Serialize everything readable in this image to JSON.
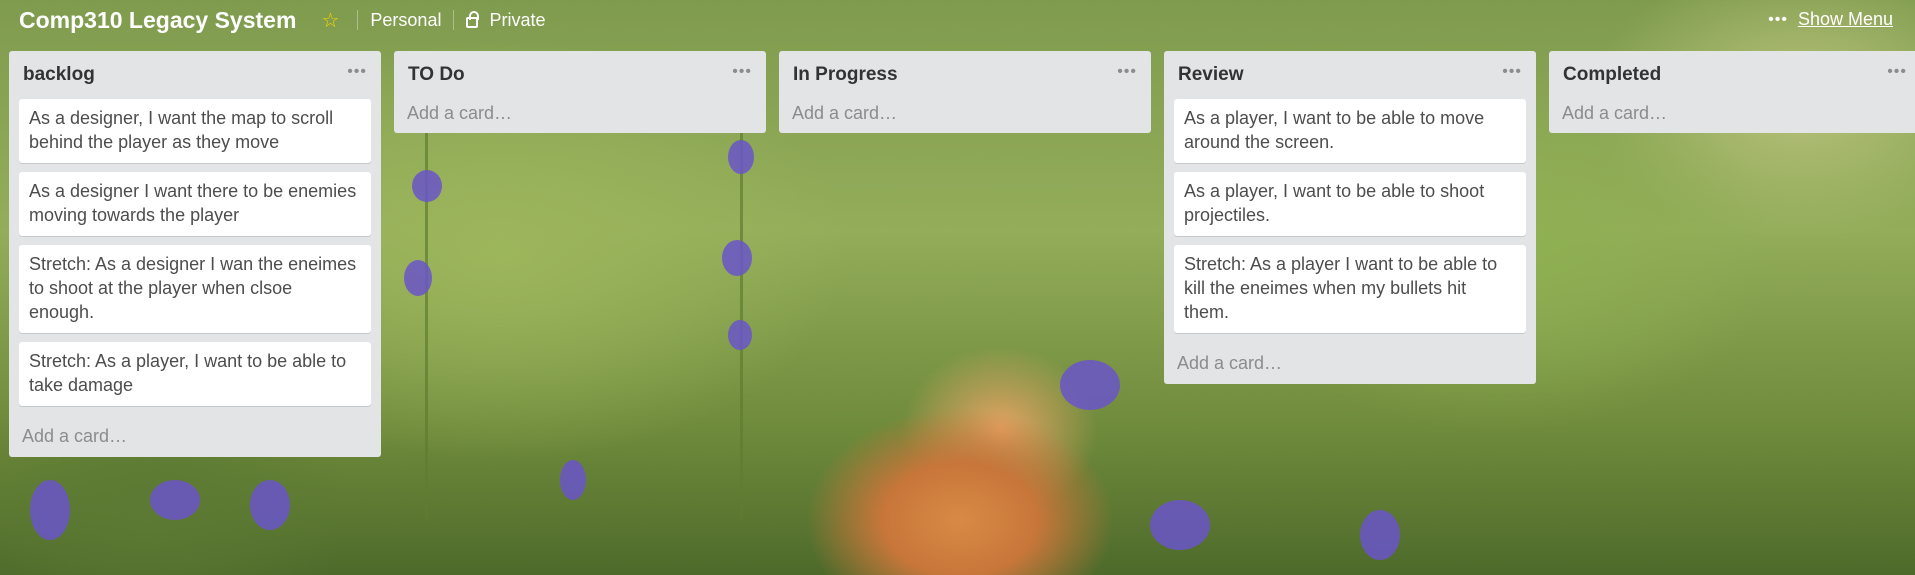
{
  "board": {
    "title": "Comp310 Legacy System",
    "visibility_team": "Personal",
    "visibility": "Private",
    "show_menu": "Show Menu",
    "star_icon": "star-icon",
    "accent_color": "#f2d600"
  },
  "lists": [
    {
      "title": "backlog",
      "cards": [
        "As a designer, I want the map to scroll behind the player as they move",
        "As a designer I want there to be enemies moving towards the player",
        "Stretch: As a designer I wan the eneimes to shoot at the player when clsoe enough.",
        "Stretch: As a player, I want to be able to take damage"
      ],
      "add_card": "Add a card…"
    },
    {
      "title": "TO Do",
      "cards": [],
      "add_card": "Add a card…"
    },
    {
      "title": "In Progress",
      "cards": [],
      "add_card": "Add a card…"
    },
    {
      "title": "Review",
      "cards": [
        "As a player, I want to be able to move around the screen.",
        "As a player, I want to be able to shoot projectiles.",
        "Stretch: As a player I want to be able to kill the eneimes when my bullets hit them."
      ],
      "add_card": "Add a card…"
    },
    {
      "title": "Completed",
      "cards": [],
      "add_card": "Add a card…"
    }
  ]
}
